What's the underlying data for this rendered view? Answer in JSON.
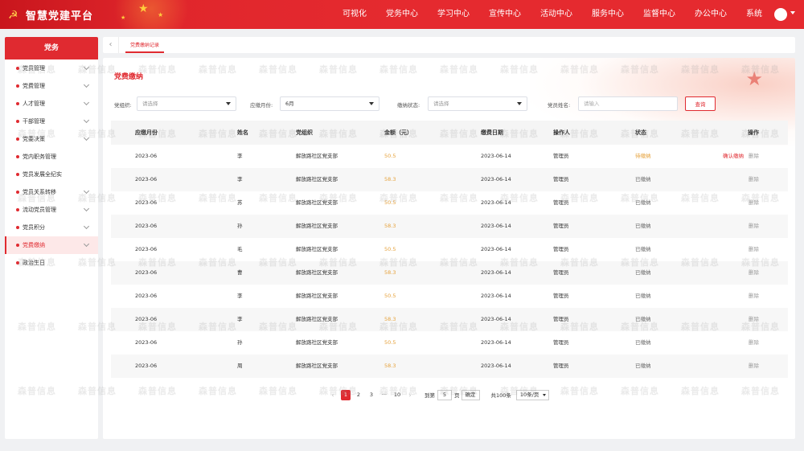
{
  "header": {
    "title": "智慧党建平台",
    "nav": [
      "可视化",
      "党务中心",
      "学习中心",
      "宣传中心",
      "活动中心",
      "服务中心",
      "监督中心",
      "办公中心",
      "系统"
    ]
  },
  "sidebar": {
    "title": "党务",
    "items": [
      {
        "label": "党员管理"
      },
      {
        "label": "党费管理"
      },
      {
        "label": "人才管理"
      },
      {
        "label": "干部管理"
      },
      {
        "label": "党委决策"
      },
      {
        "label": "党内职务管理"
      },
      {
        "label": "党员发展全纪实"
      },
      {
        "label": "党员关系转移"
      },
      {
        "label": "流动党员管理"
      },
      {
        "label": "党员积分"
      },
      {
        "label": "党费缴纳"
      },
      {
        "label": "政治生日"
      }
    ]
  },
  "tabs": {
    "current": "党费缴纳记录"
  },
  "page": {
    "title": "党费缴纳",
    "filters": {
      "org_label": "党组织:",
      "org_placeholder": "请选择",
      "month_label": "应缴月份:",
      "month_value": "6月",
      "status_label": "缴纳状态:",
      "status_placeholder": "请选择",
      "name_label": "党员姓名:",
      "name_placeholder": "请输入",
      "query_button": "查询"
    }
  },
  "table": {
    "headers": [
      "应缴月份",
      "姓名",
      "党组织",
      "金额（元）",
      "缴费日期",
      "操作人",
      "状态",
      "操作"
    ],
    "rows": [
      {
        "month": "2023-06",
        "name": "李",
        "org": "解放路社区党支部",
        "amount": "50.5",
        "date": "2023-06-14",
        "operator": "管理员",
        "status": "待缴纳",
        "confirm": "确认缴纳",
        "delete": "删除"
      },
      {
        "month": "2023-06",
        "name": "李",
        "org": "解放路社区党支部",
        "amount": "58.3",
        "date": "2023-06-14",
        "operator": "管理员",
        "status": "已缴纳",
        "confirm": "",
        "delete": "删除"
      },
      {
        "month": "2023-06",
        "name": "苏",
        "org": "解放路社区党支部",
        "amount": "50.5",
        "date": "2023-06-14",
        "operator": "管理员",
        "status": "已缴纳",
        "confirm": "",
        "delete": "删除"
      },
      {
        "month": "2023-06",
        "name": "孙",
        "org": "解放路社区党支部",
        "amount": "58.3",
        "date": "2023-06-14",
        "operator": "管理员",
        "status": "已缴纳",
        "confirm": "",
        "delete": "删除"
      },
      {
        "month": "2023-06",
        "name": "毛",
        "org": "解放路社区党支部",
        "amount": "50.5",
        "date": "2023-06-14",
        "operator": "管理员",
        "status": "已缴纳",
        "confirm": "",
        "delete": "删除"
      },
      {
        "month": "2023-06",
        "name": "曹",
        "org": "解放路社区党支部",
        "amount": "58.3",
        "date": "2023-06-14",
        "operator": "管理员",
        "status": "已缴纳",
        "confirm": "",
        "delete": "删除"
      },
      {
        "month": "2023-06",
        "name": "李",
        "org": "解放路社区党支部",
        "amount": "50.5",
        "date": "2023-06-14",
        "operator": "管理员",
        "status": "已缴纳",
        "confirm": "",
        "delete": "删除"
      },
      {
        "month": "2023-06",
        "name": "李",
        "org": "解放路社区党支部",
        "amount": "58.3",
        "date": "2023-06-14",
        "operator": "管理员",
        "status": "已缴纳",
        "confirm": "",
        "delete": "删除"
      },
      {
        "month": "2023-06",
        "name": "孙",
        "org": "解放路社区党支部",
        "amount": "50.5",
        "date": "2023-06-14",
        "operator": "管理员",
        "status": "已缴纳",
        "confirm": "",
        "delete": "删除"
      },
      {
        "month": "2023-06",
        "name": "周",
        "org": "解放路社区党支部",
        "amount": "58.3",
        "date": "2023-06-14",
        "operator": "管理员",
        "status": "已缴纳",
        "confirm": "",
        "delete": "删除"
      }
    ]
  },
  "pagination": {
    "pages": [
      "1",
      "2",
      "3",
      "···",
      "10"
    ],
    "current": "1",
    "goto_prefix": "到第",
    "goto_value": "5",
    "goto_suffix": "页",
    "confirm": "确定",
    "total": "共100条",
    "page_size": "10条/页"
  },
  "watermark": "森普信息",
  "colors": {
    "brand_red": "#e02a30",
    "amount_orange": "#e6a23c"
  },
  "icons": {
    "logo": "party-emblem-icon",
    "back": "chevron-left-icon",
    "user": "avatar-icon"
  }
}
